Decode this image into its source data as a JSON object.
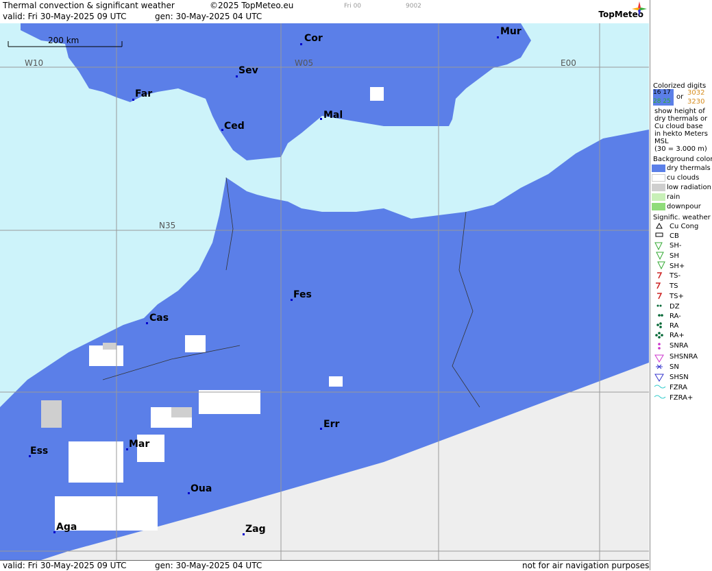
{
  "header": {
    "title": "Thermal convection & significant weather",
    "copyright": "©2025 TopMeteo.eu",
    "frame": "Fri 00",
    "code": "9002",
    "valid": "valid:  Fri  30-May-2025  09 UTC",
    "gen": "gen: 30-May-2025 04 UTC",
    "logo": "TopMeteo"
  },
  "map": {
    "scale_label": "200 km",
    "grid_labels": [
      "W10",
      "W05",
      "E00",
      "N35"
    ],
    "cities": [
      "Mur",
      "Cor",
      "Sev",
      "Far",
      "Ced",
      "Mal",
      "Fes",
      "Cas",
      "Mar",
      "Ess",
      "Err",
      "Oua",
      "Aga",
      "Zag"
    ],
    "colors": {
      "sea": "#cdf3fa",
      "dry_thermals": "#5b7fe8",
      "cu_clouds": "#ffffff",
      "low_radiation": "#cfcfcf",
      "outside": "#eeeeee"
    }
  },
  "footer": {
    "valid": "valid:  Fri  30-May-2025  09 UTC",
    "gen": "gen: 30-May-2025 04 UTC",
    "disclaimer": "not for air navigation purposes"
  },
  "legend": {
    "colorized_title": "Colorized digits",
    "sample_a": "16 17",
    "sample_b": "28 25",
    "or": "or",
    "sample_c": "3032",
    "sample_d": "3230",
    "desc": [
      "show height of",
      "dry thermals or",
      "Cu cloud base",
      "in hekto Meters",
      "MSL",
      "(30 = 3.000 m)"
    ],
    "bg_title": "Background color",
    "bg_items": [
      {
        "label": "dry thermals",
        "color": "#5b7fe8"
      },
      {
        "label": "cu clouds",
        "color": "#ffffff"
      },
      {
        "label": "low radiation",
        "color": "#cfcfcf"
      },
      {
        "label": "rain",
        "color": "#c8f0b8"
      },
      {
        "label": "downpour",
        "color": "#8fdc7a"
      }
    ],
    "wx_title": "Signific. weather",
    "wx_items": [
      "Cu Cong",
      "CB",
      "SH-",
      "SH",
      "SH+",
      "TS-",
      "TS",
      "TS+",
      "DZ",
      "RA-",
      "RA",
      "RA+",
      "SNRA",
      "SHSNRA",
      "SN",
      "SHSN",
      "FZRA",
      "FZRA+"
    ]
  }
}
